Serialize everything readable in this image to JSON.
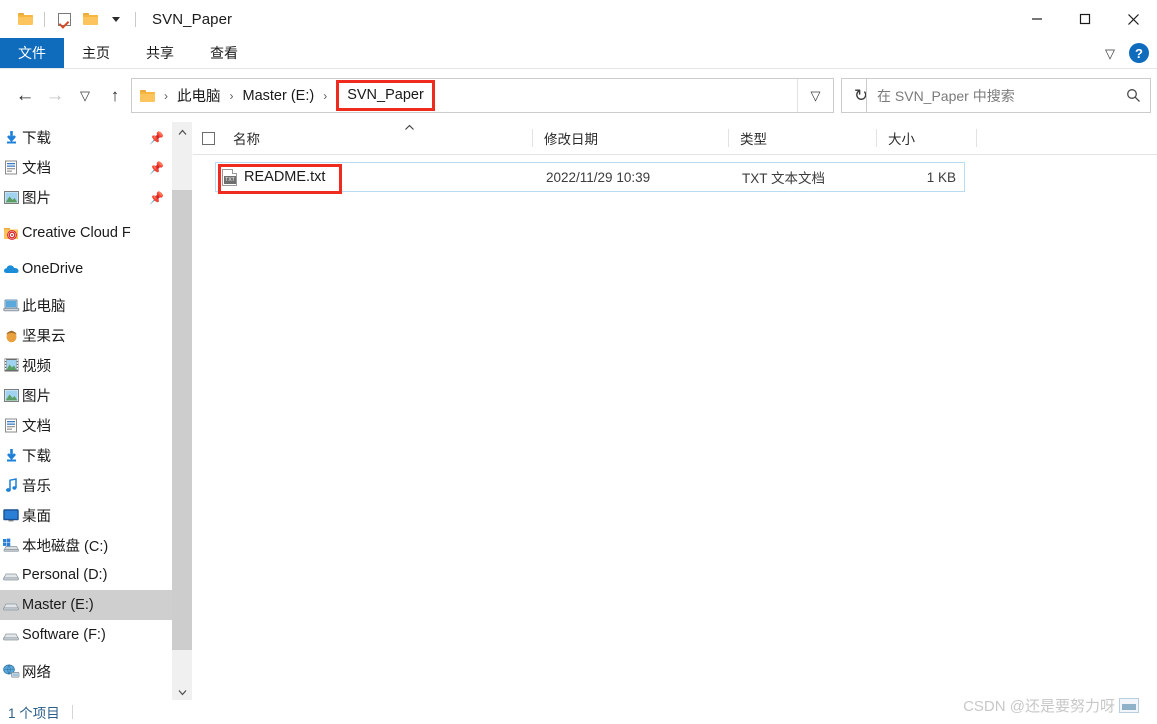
{
  "window": {
    "title": "SVN_Paper",
    "quick_access": [
      {
        "name": "folder-icon",
        "label": ""
      },
      {
        "name": "properties-icon",
        "label": ""
      },
      {
        "name": "new-folder-icon",
        "label": ""
      },
      {
        "name": "customize-dropdown-icon",
        "label": ""
      }
    ],
    "controls": {
      "minimize": "—",
      "maximize": "□",
      "close": "✕"
    }
  },
  "ribbon": {
    "tabs": [
      {
        "label": "文件",
        "active": true
      },
      {
        "label": "主页",
        "active": false
      },
      {
        "label": "共享",
        "active": false
      },
      {
        "label": "查看",
        "active": false
      }
    ],
    "expand_icon": "chevron-down-icon",
    "help_label": "?"
  },
  "navigation": {
    "back": "←",
    "forward": "→",
    "recent": "⌄",
    "up": "↑",
    "refresh": "↻",
    "dropdown": "⌄"
  },
  "breadcrumb": {
    "items": [
      "此电脑",
      "Master (E:)",
      "SVN_Paper"
    ],
    "separator": "›",
    "highlighted_index": 2,
    "highlight_color": "#ef2b20"
  },
  "search": {
    "placeholder": "在 SVN_Paper 中搜索",
    "icon": "search-icon"
  },
  "sidebar": {
    "groups": [
      {
        "items": [
          {
            "label": "下载",
            "icon": "download-icon",
            "pinned": true,
            "selected": false
          },
          {
            "label": "文档",
            "icon": "document-icon",
            "pinned": true,
            "selected": false
          },
          {
            "label": "图片",
            "icon": "pictures-icon",
            "pinned": true,
            "selected": false
          }
        ]
      },
      {
        "items": [
          {
            "label": "Creative Cloud F",
            "icon": "creative-cloud-folder-icon",
            "pinned": false,
            "selected": false
          }
        ]
      },
      {
        "items": [
          {
            "label": "OneDrive",
            "icon": "onedrive-icon",
            "pinned": false,
            "selected": false
          }
        ]
      },
      {
        "items": [
          {
            "label": "此电脑",
            "icon": "this-pc-icon",
            "pinned": false,
            "selected": false
          },
          {
            "label": "坚果云",
            "icon": "nutstore-icon",
            "pinned": false,
            "selected": false
          },
          {
            "label": "视频",
            "icon": "videos-icon",
            "pinned": false,
            "selected": false
          },
          {
            "label": "图片",
            "icon": "pictures-icon",
            "pinned": false,
            "selected": false
          },
          {
            "label": "文档",
            "icon": "document-icon",
            "pinned": false,
            "selected": false
          },
          {
            "label": "下载",
            "icon": "download-icon",
            "pinned": false,
            "selected": false
          },
          {
            "label": "音乐",
            "icon": "music-icon",
            "pinned": false,
            "selected": false
          },
          {
            "label": "桌面",
            "icon": "desktop-icon",
            "pinned": false,
            "selected": false
          },
          {
            "label": "本地磁盘 (C:)",
            "icon": "windows-drive-icon",
            "pinned": false,
            "selected": false
          },
          {
            "label": "Personal (D:)",
            "icon": "drive-icon",
            "pinned": false,
            "selected": false
          },
          {
            "label": "Master (E:)",
            "icon": "drive-icon",
            "pinned": false,
            "selected": true
          },
          {
            "label": "Software (F:)",
            "icon": "drive-icon",
            "pinned": false,
            "selected": false
          }
        ]
      },
      {
        "items": [
          {
            "label": "网络",
            "icon": "network-icon",
            "pinned": false,
            "selected": false
          }
        ]
      }
    ],
    "scrollbar": {
      "up": "⌃",
      "down": "⌄"
    }
  },
  "file_list": {
    "columns": [
      {
        "label": "名称",
        "sorted": true,
        "sort_icon": "⌃"
      },
      {
        "label": "修改日期",
        "sorted": false,
        "sort_icon": ""
      },
      {
        "label": "类型",
        "sorted": false,
        "sort_icon": ""
      },
      {
        "label": "大小",
        "sorted": false,
        "sort_icon": ""
      }
    ],
    "rows": [
      {
        "name": "README.txt",
        "icon": "txt-file-icon",
        "icon_label": "TXT",
        "date": "2022/11/29 10:39",
        "type": "TXT 文本文档",
        "size": "1 KB",
        "highlighted": true
      }
    ]
  },
  "status_bar": {
    "item_count": "1 个项目"
  },
  "watermark": {
    "text": "CSDN @还是要努力呀"
  }
}
